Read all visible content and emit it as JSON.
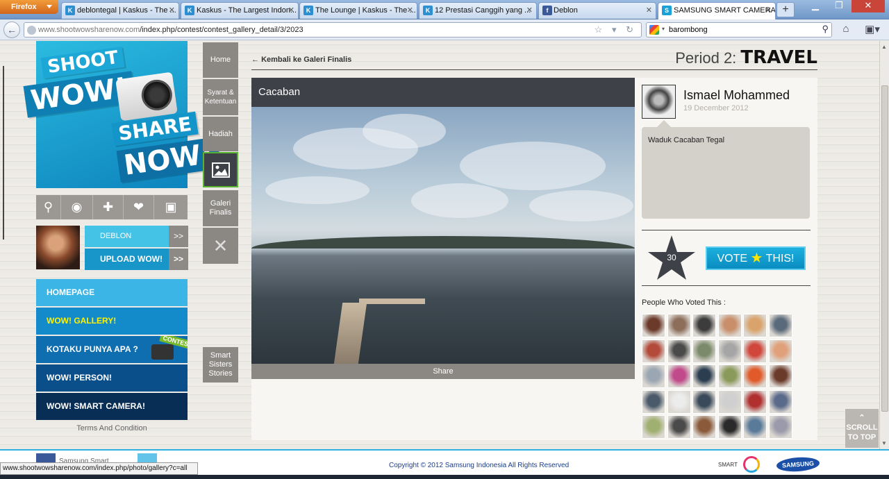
{
  "browser": {
    "menu_button": "Firefox",
    "tabs": [
      {
        "label": "deblontegal | Kaskus - The ...",
        "favicon": "kaskus"
      },
      {
        "label": "Kaskus - The Largest Indon...",
        "favicon": "kaskus"
      },
      {
        "label": "The Lounge | Kaskus - The ...",
        "favicon": "kaskus"
      },
      {
        "label": "12 Prestasi Canggih yang ...",
        "favicon": "kaskus"
      },
      {
        "label": "Deblon",
        "favicon": "facebook"
      },
      {
        "label": "SAMSUNG SMART CAMERA...",
        "favicon": "samsung"
      }
    ],
    "url_host": "www.shootwowsharenow.com",
    "url_path": "/index.php/contest/contest_gallery_detail/3/2023",
    "search_value": "barombong",
    "status_url": "www.shootwowsharenow.com/index.php/photo/gallery?c=all"
  },
  "logo": {
    "line1": "SHOOT",
    "line2": "WOW!",
    "line3": "SHARE",
    "line4": "NOW!"
  },
  "user": {
    "name": "DEBLON",
    "upload_label": "UPLOAD WOW!",
    "chevron": ">>"
  },
  "menu": [
    {
      "label": "HOMEPAGE"
    },
    {
      "label": "WOW! GALLERY!"
    },
    {
      "label": "KOTAKU PUNYA APA ?",
      "badge": "CONTEST"
    },
    {
      "label": "WOW! PERSON!"
    },
    {
      "label": "WOW! SMART CAMERA!"
    }
  ],
  "terms": "Terms And Condition",
  "side_nav": {
    "home": "Home",
    "syarat": "Syarat & Ketentuan",
    "hadiah": "Hadiah",
    "galeri": "Galeri Finalis",
    "smart": "Smart Sisters Stories"
  },
  "content": {
    "back_link": "Kembali ke Galeri Finalis",
    "period_prefix": "Period 2:",
    "period_theme": "TRAVEL",
    "photo_title": "Cacaban",
    "share_label": "Share",
    "uploader": "Ismael Mohammed",
    "date": "19 December 2012",
    "description": "Waduk Cacaban Tegal",
    "vote_count": "30",
    "vote_btn_left": "VOTE",
    "vote_btn_right": "THIS!",
    "voters_label": "People Who Voted This :"
  },
  "scroll_top": {
    "line1": "SCROLL",
    "line2": "TO TOP"
  },
  "footer": {
    "copyright": "Copyright © 2012 Samsung Indonesia All Rights Reserved",
    "fb_label": "Samsung Smart",
    "smart_camera": "SMART CAMERA",
    "samsung": "SAMSUNG"
  },
  "colors": {
    "accent_blue": "#1996c9",
    "vote_star": "#3f4148",
    "side_nav": "#8b8884"
  }
}
